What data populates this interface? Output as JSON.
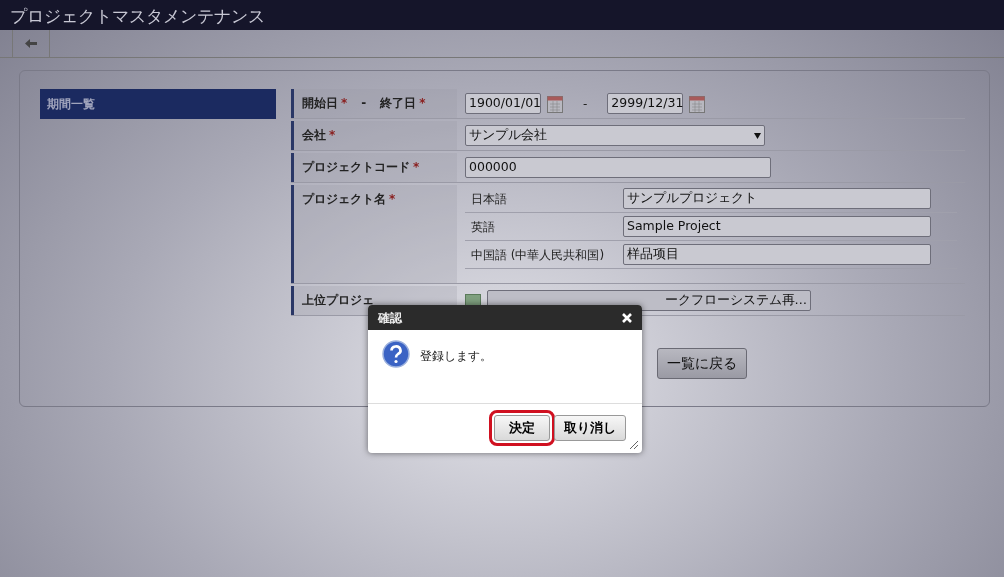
{
  "window": {
    "title": "プロジェクトマスタメンテナンス"
  },
  "sidebar": {
    "items": [
      {
        "label": "期間一覧",
        "selected": true
      }
    ]
  },
  "form": {
    "rows": [
      {
        "kind": "daterange",
        "label": "開始日",
        "mark": "*",
        "separator": "-",
        "label2": "終了日",
        "mark2": "*",
        "start": "1900/01/01",
        "between": "-",
        "end": "2999/12/31"
      },
      {
        "kind": "select",
        "label": "会社",
        "mark": "*",
        "value": "サンプル会社"
      },
      {
        "kind": "text",
        "label": "プロジェクトコード",
        "mark": "*",
        "value": "000000"
      },
      {
        "kind": "multilang",
        "label": "プロジェクト名",
        "mark": "*",
        "entries": [
          {
            "lang": "日本語",
            "value": "サンプルプロジェクト"
          },
          {
            "lang": "英語",
            "value": "Sample Project"
          },
          {
            "lang": "中国語 (中華人民共和国)",
            "value": "样品项目"
          }
        ]
      },
      {
        "kind": "picker",
        "label": "上位プロジェ",
        "value": "ークフローシステム再…"
      }
    ]
  },
  "buttons": [
    {
      "label": "一覧に戻る"
    }
  ],
  "dialog": {
    "title": "確認",
    "message": "登録します。",
    "buttons": [
      {
        "label": "決定",
        "focused": true
      },
      {
        "label": "取り消し",
        "focused": false
      }
    ]
  }
}
